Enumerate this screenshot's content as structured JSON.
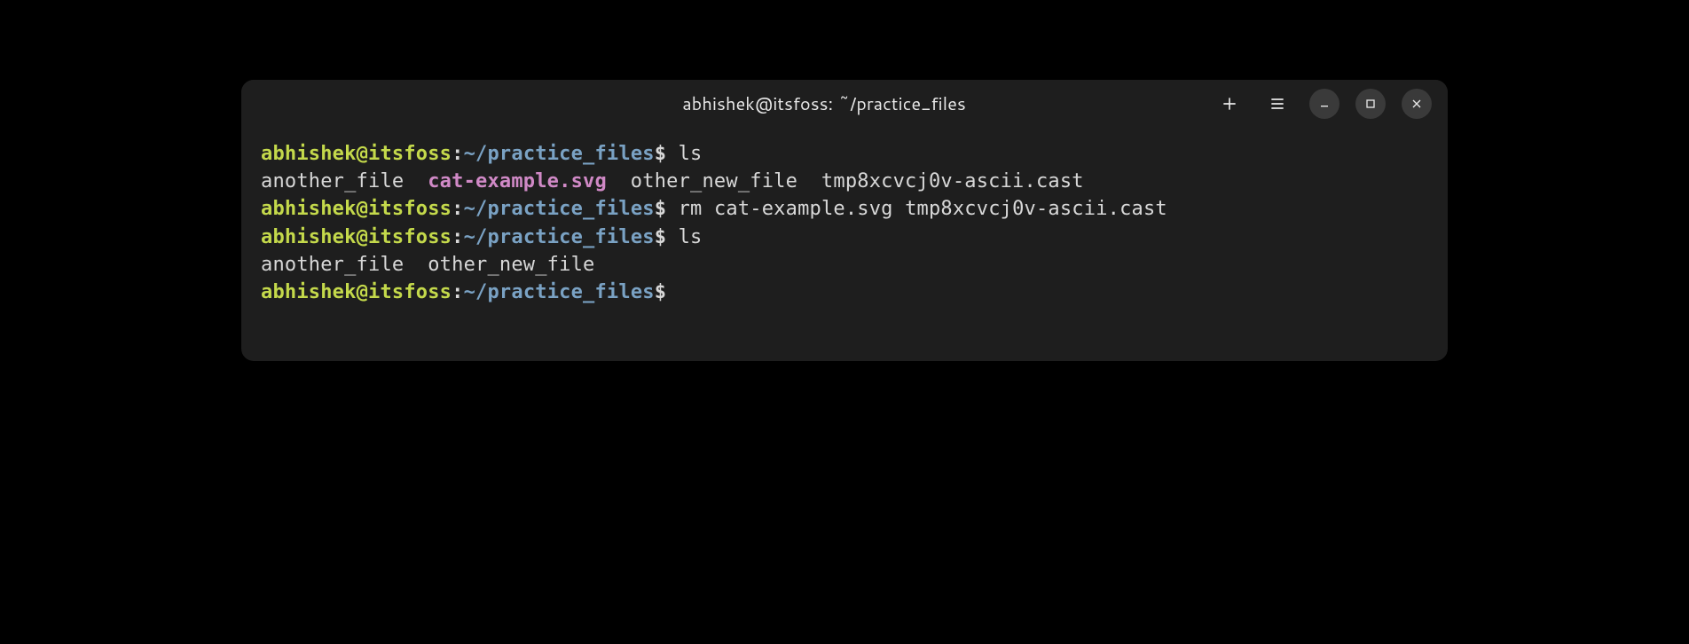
{
  "window": {
    "title": "abhishek@itsfoss: ~/practice_files"
  },
  "prompt": {
    "user": "abhishek",
    "at": "@",
    "host": "itsfoss",
    "colon": ":",
    "path": "~/practice_files",
    "dollar": "$"
  },
  "lines": {
    "cmd1": " ls",
    "out1_a": "another_file  ",
    "out1_svg": "cat-example.svg",
    "out1_b": "  other_new_file  tmp8xcvcj0v-ascii.cast",
    "cmd2": " rm cat-example.svg tmp8xcvcj0v-ascii.cast",
    "cmd3": " ls",
    "out3": "another_file  other_new_file",
    "cmd4": " "
  }
}
